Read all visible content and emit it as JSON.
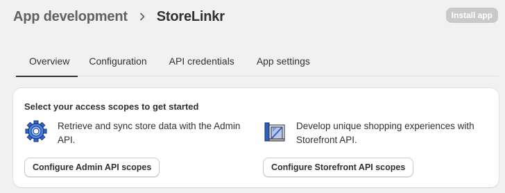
{
  "header": {
    "breadcrumb_parent": "App development",
    "breadcrumb_current": "StoreLinkr",
    "install_button": "Install app"
  },
  "tabs": [
    {
      "label": "Overview",
      "active": true
    },
    {
      "label": "Configuration",
      "active": false
    },
    {
      "label": "API credentials",
      "active": false
    },
    {
      "label": "App settings",
      "active": false
    }
  ],
  "card": {
    "title": "Select your access scopes to get started",
    "admin": {
      "icon": "gear-icon",
      "description": "Retrieve and sync store data with the Admin API.",
      "button": "Configure Admin API scopes"
    },
    "storefront": {
      "icon": "storefront-icon",
      "description": "Develop unique shopping experiences with Storefront API.",
      "button": "Configure Storefront API scopes"
    }
  },
  "colors": {
    "background": "#f1f1f1",
    "text_primary": "#303030",
    "text_secondary": "#616161",
    "install_disabled": "#c9c9c9",
    "icon_blue": "#3a6fd8"
  }
}
